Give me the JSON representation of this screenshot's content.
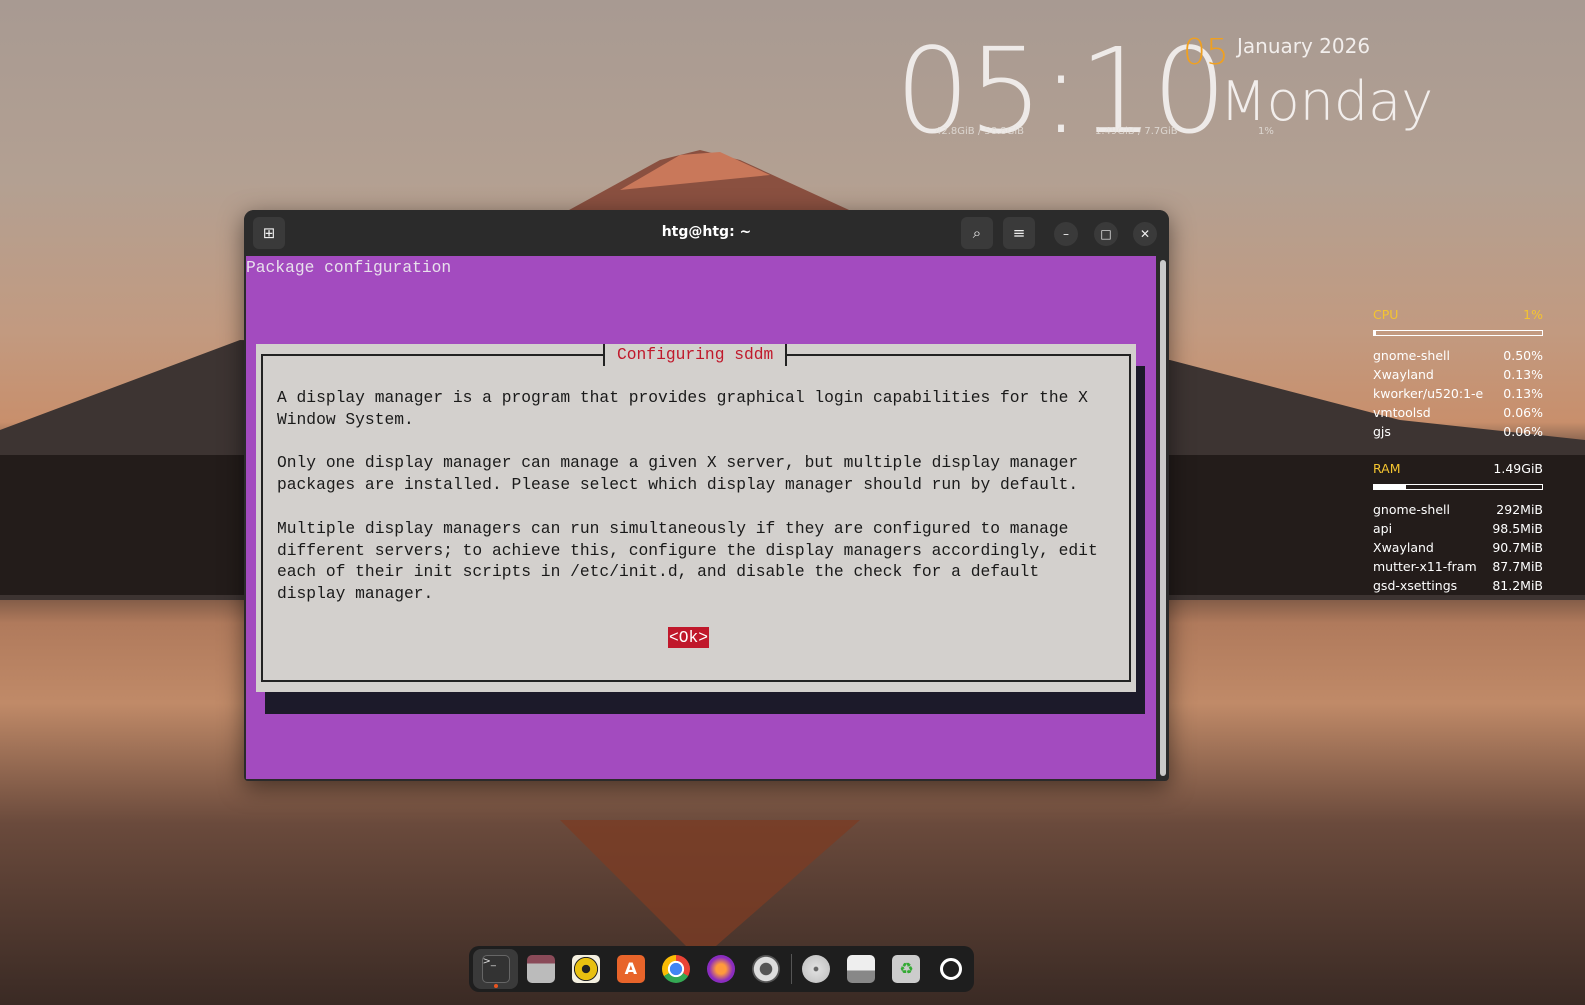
{
  "desktop": {
    "clock": {
      "time": "05:10",
      "day_number": "05",
      "month_year": "January 2026",
      "weekday": "Monday",
      "disk": "42.8GiB / 58.8GiB",
      "memory": "1.49GiB / 7.7GiB",
      "cpu": "1%"
    },
    "sysmon": {
      "cpu": {
        "label": "CPU",
        "value": "1%",
        "fraction": 0.01,
        "processes": [
          {
            "name": "gnome-shell",
            "value": "0.50%"
          },
          {
            "name": "Xwayland",
            "value": "0.13%"
          },
          {
            "name": "kworker/u520:1-e",
            "value": "0.13%"
          },
          {
            "name": "vmtoolsd",
            "value": "0.06%"
          },
          {
            "name": "gjs",
            "value": "0.06%"
          }
        ]
      },
      "ram": {
        "label": "RAM",
        "value": "1.49GiB",
        "fraction": 0.19,
        "processes": [
          {
            "name": "gnome-shell",
            "value": "292MiB"
          },
          {
            "name": "api",
            "value": "98.5MiB"
          },
          {
            "name": "Xwayland",
            "value": "90.7MiB"
          },
          {
            "name": "mutter-x11-fram",
            "value": "87.7MiB"
          },
          {
            "name": "gsd-xsettings",
            "value": "81.2MiB"
          }
        ]
      }
    }
  },
  "terminal": {
    "title": "htg@htg: ~",
    "header": "Package configuration",
    "dialog": {
      "title": "Configuring sddm",
      "body": "A display manager is a program that provides graphical login capabilities for the X\nWindow System.\n\nOnly one display manager can manage a given X server, but multiple display manager\npackages are installed. Please select which display manager should run by default.\n\nMultiple display managers can run simultaneously if they are configured to manage\ndifferent servers; to achieve this, configure the display managers accordingly, edit\neach of their init scripts in /etc/init.d, and disable the check for a default\ndisplay manager.",
      "ok_button": "<Ok>"
    }
  },
  "dock": {
    "items": [
      "terminal",
      "files",
      "rhythmbox",
      "app-center",
      "chrome",
      "firefox-dev",
      "settings",
      "disc",
      "save-drive",
      "trash",
      "ubuntu"
    ]
  }
}
